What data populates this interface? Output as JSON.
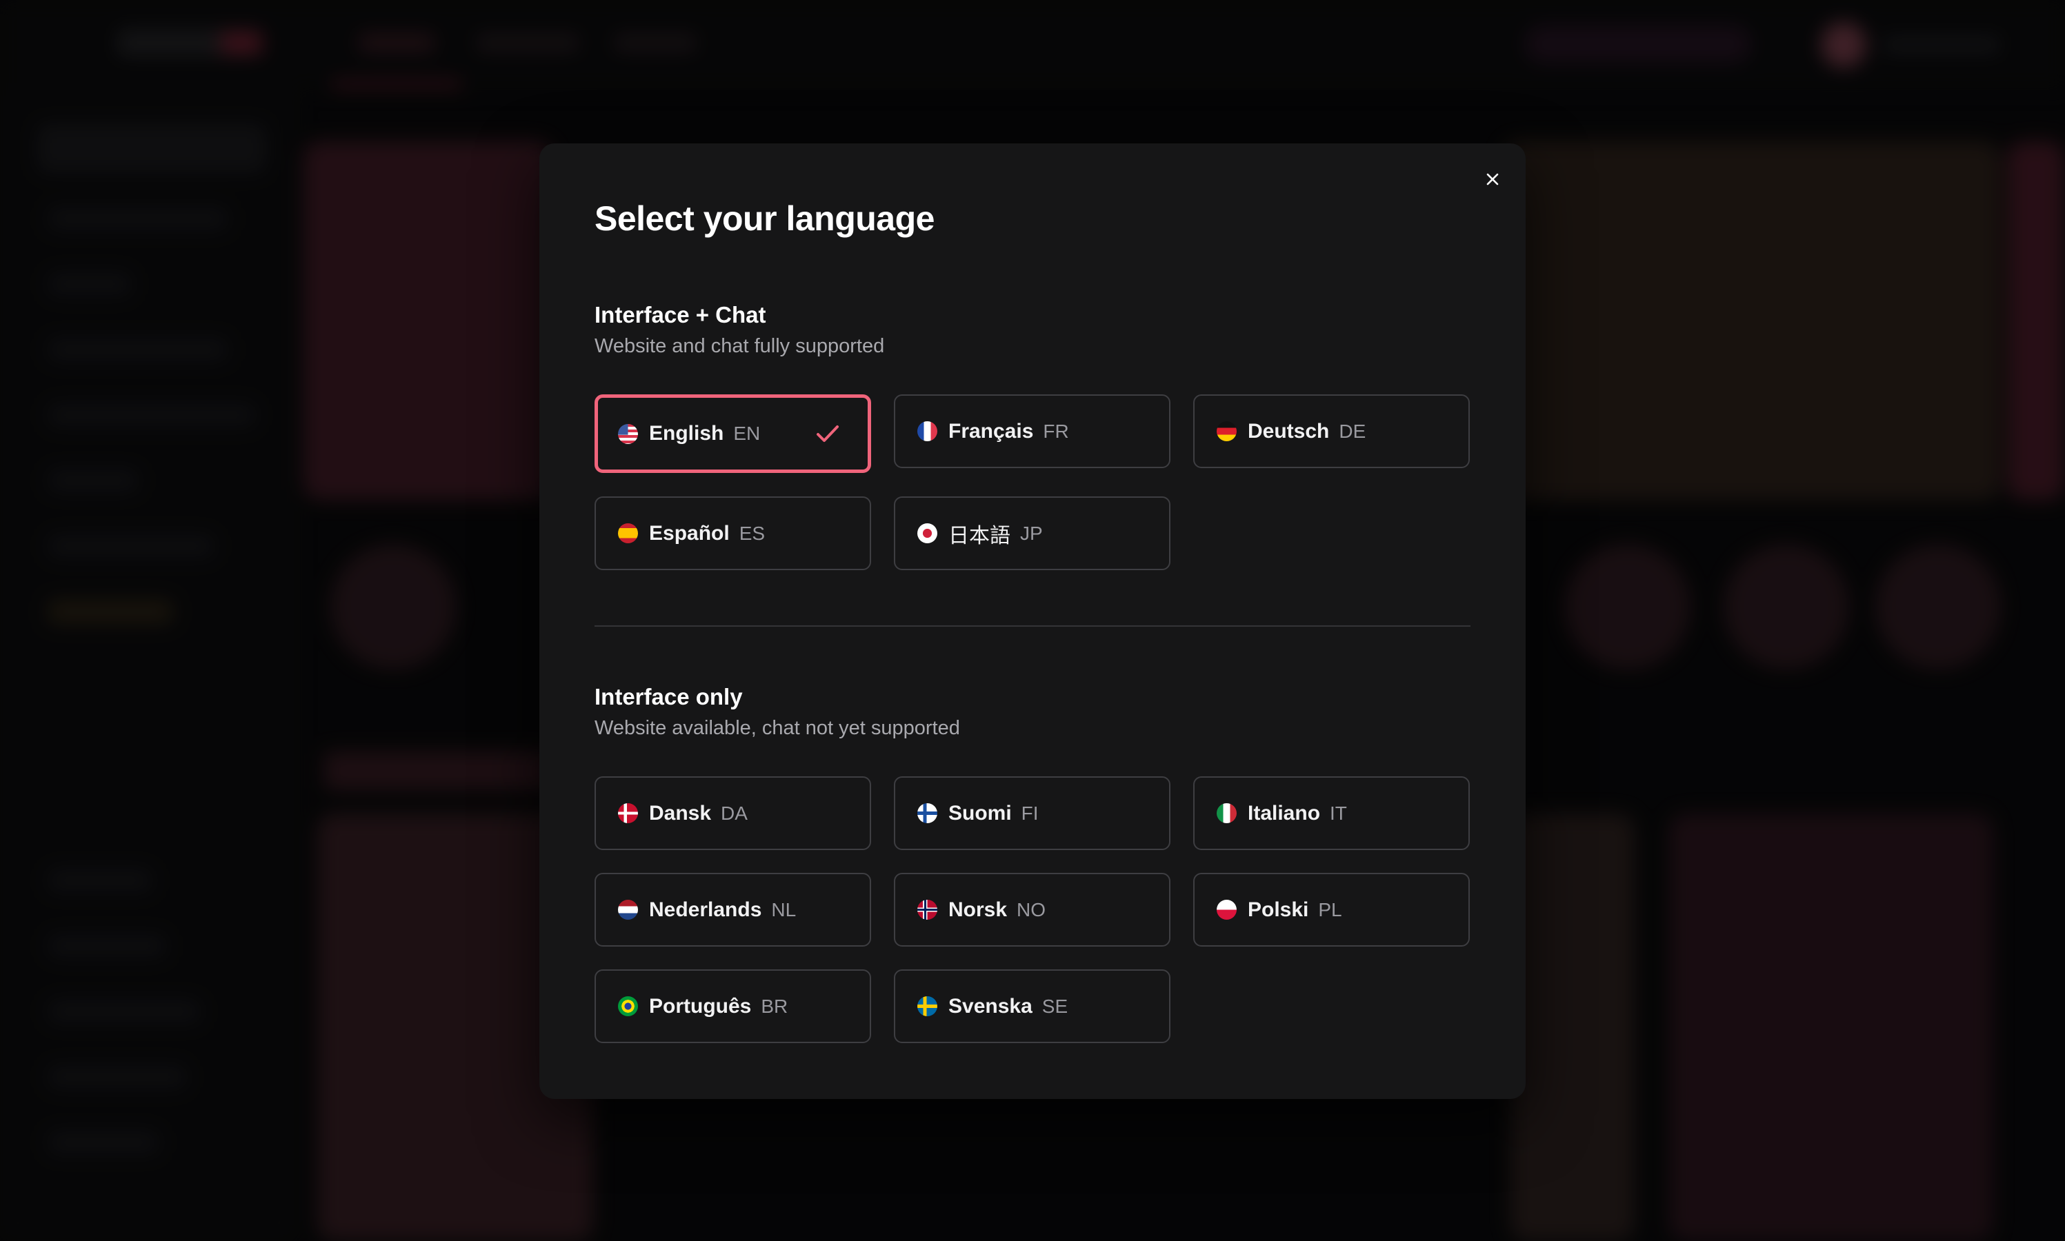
{
  "modal": {
    "title": "Select your language",
    "close_icon": "close-icon"
  },
  "sections": {
    "full": {
      "title": "Interface + Chat",
      "subtitle": "Website and chat fully supported"
    },
    "interface_only": {
      "title": "Interface only",
      "subtitle": "Website available, chat not yet supported"
    }
  },
  "languages_full": [
    {
      "name": "English",
      "code": "EN",
      "flag": "us-flag-icon",
      "selected": true
    },
    {
      "name": "Français",
      "code": "FR",
      "flag": "fr-flag-icon",
      "selected": false
    },
    {
      "name": "Deutsch",
      "code": "DE",
      "flag": "de-flag-icon",
      "selected": false
    },
    {
      "name": "Español",
      "code": "ES",
      "flag": "es-flag-icon",
      "selected": false
    },
    {
      "name": "日本語",
      "code": "JP",
      "flag": "jp-flag-icon",
      "selected": false
    }
  ],
  "languages_interface": [
    {
      "name": "Dansk",
      "code": "DA",
      "flag": "dk-flag-icon"
    },
    {
      "name": "Suomi",
      "code": "FI",
      "flag": "fi-flag-icon"
    },
    {
      "name": "Italiano",
      "code": "IT",
      "flag": "it-flag-icon"
    },
    {
      "name": "Nederlands",
      "code": "NL",
      "flag": "nl-flag-icon"
    },
    {
      "name": "Norsk",
      "code": "NO",
      "flag": "no-flag-icon"
    },
    {
      "name": "Polski",
      "code": "PL",
      "flag": "pl-flag-icon"
    },
    {
      "name": "Português",
      "code": "BR",
      "flag": "br-flag-icon"
    },
    {
      "name": "Svenska",
      "code": "SE",
      "flag": "se-flag-icon"
    }
  ],
  "colors": {
    "accent": "#f0647b",
    "modal_bg": "#161617",
    "border": "#3e3e42"
  }
}
